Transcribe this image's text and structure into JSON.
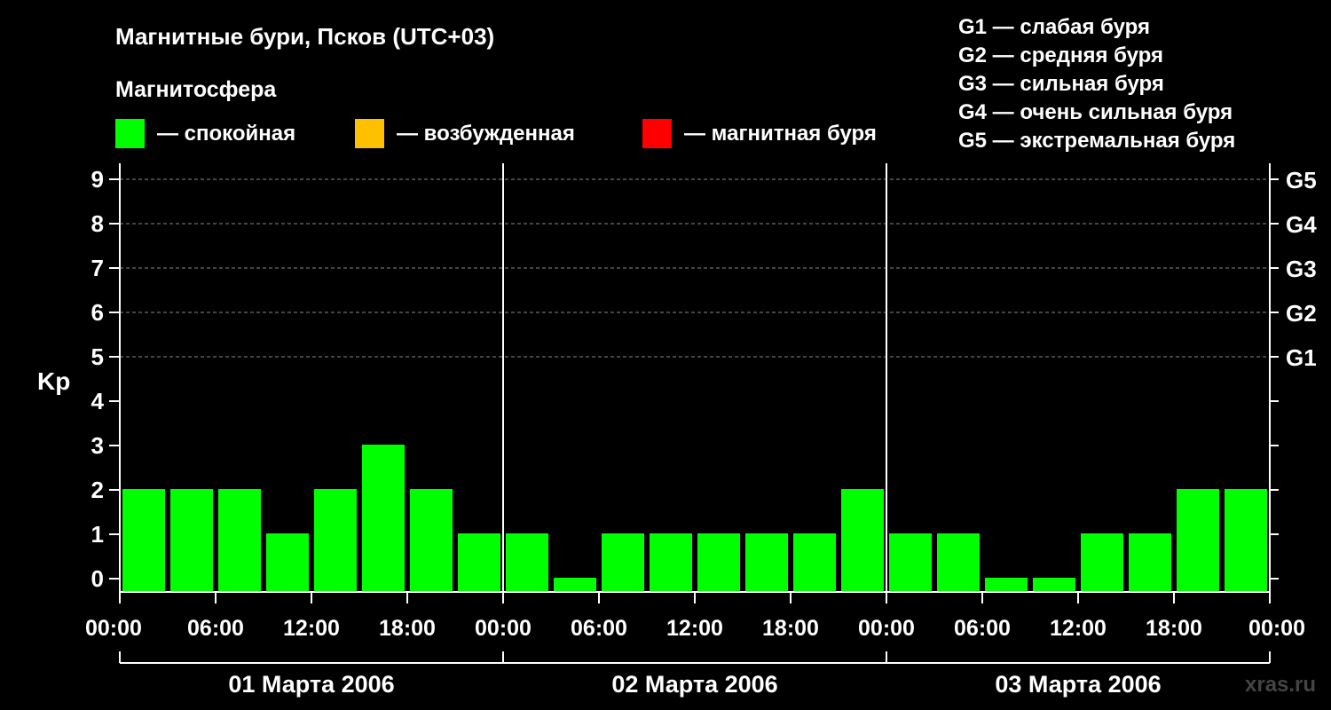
{
  "title": "Магнитные бури, Псков (UTC+03)",
  "magnetosphere_label": "Магнитосфера",
  "state_legend": [
    {
      "label": "— спокойная",
      "color": "#00ff00"
    },
    {
      "label": "— возбужденная",
      "color": "#ffc000"
    },
    {
      "label": "— магнитная буря",
      "color": "#ff0000"
    }
  ],
  "storm_legend": [
    "G1 — слабая буря",
    "G2 — средняя буря",
    "G3 — сильная буря",
    "G4 — очень сильная буря",
    "G5 — экстремальная буря"
  ],
  "watermark": "xras.ru",
  "chart_data": {
    "type": "bar",
    "ylabel": "Kp",
    "ylim": [
      0,
      9
    ],
    "yticks": [
      "0",
      "1",
      "2",
      "3",
      "4",
      "5",
      "6",
      "7",
      "8",
      "9"
    ],
    "right_ticks": [
      {
        "kp": 5,
        "label": "G1"
      },
      {
        "kp": 6,
        "label": "G2"
      },
      {
        "kp": 7,
        "label": "G3"
      },
      {
        "kp": 8,
        "label": "G4"
      },
      {
        "kp": 9,
        "label": "G5"
      }
    ],
    "grid_dashed_levels": [
      5,
      6,
      7,
      8,
      9
    ],
    "xtick_labels": [
      "00:00",
      "06:00",
      "12:00",
      "18:00",
      "00:00",
      "06:00",
      "12:00",
      "18:00",
      "00:00",
      "06:00",
      "12:00",
      "18:00",
      "00:00"
    ],
    "days": [
      "01 Марта 2006",
      "02 Марта 2006",
      "03 Марта 2006"
    ],
    "interval_hours": 3,
    "values": [
      2,
      2,
      2,
      1,
      2,
      3,
      2,
      1,
      1,
      0,
      1,
      1,
      1,
      1,
      1,
      2,
      1,
      1,
      0,
      0,
      1,
      1,
      2,
      2
    ],
    "color": "#00ff00",
    "grid": true
  }
}
